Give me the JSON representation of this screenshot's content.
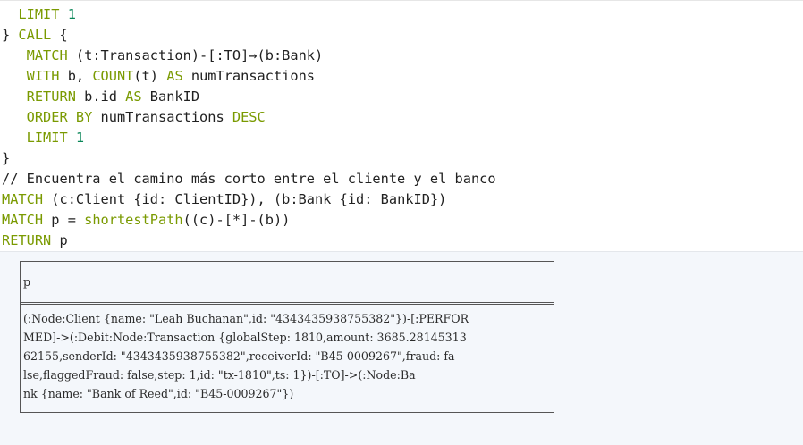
{
  "code": {
    "lines": [
      [
        "  ",
        "LIMIT",
        " ",
        "1"
      ],
      [
        "} ",
        "CALL",
        " {"
      ],
      [
        "   ",
        "MATCH",
        " (t:Transaction)-[:TO]→(b:Bank)"
      ],
      [
        "   ",
        "WITH",
        " b, ",
        "COUNT",
        "(t) ",
        "AS",
        " numTransactions"
      ],
      [
        "   ",
        "RETURN",
        " b.id ",
        "AS",
        " BankID"
      ],
      [
        "   ",
        "ORDER BY",
        " numTransactions ",
        "DESC"
      ],
      [
        "   ",
        "LIMIT",
        " ",
        "1"
      ],
      [
        "}"
      ],
      [
        "// Encuentra el camino más corto entre el cliente y el banco"
      ],
      [
        "MATCH",
        " (c:Client {id: ClientID}), (b:Bank {id: BankID})"
      ],
      [
        "MATCH",
        " p = ",
        "shortestPath",
        "((c)-[*]-(b))"
      ],
      [
        "RETURN",
        " p"
      ]
    ]
  },
  "output": {
    "column_header": "p",
    "rows": [
      "(:Node:Client {name: \"Leah Buchanan\",id: \"4343435938755382\"})-[:PERFOR",
      "MED]->(:Debit:Node:Transaction {globalStep: 1810,amount: 3685.28145313",
      "62155,senderId: \"4343435938755382\",receiverId: \"B45-0009267\",fraud: fa",
      "lse,flaggedFraud: false,step: 1,id: \"tx-1810\",ts: 1})-[:TO]->(:Node:Ba",
      "nk {name: \"Bank of Reed\",id: \"B45-0009267\"})"
    ]
  },
  "colors": {
    "keyword": "#7a9a01",
    "number": "#098658",
    "output_background": "#f4f7fb"
  }
}
